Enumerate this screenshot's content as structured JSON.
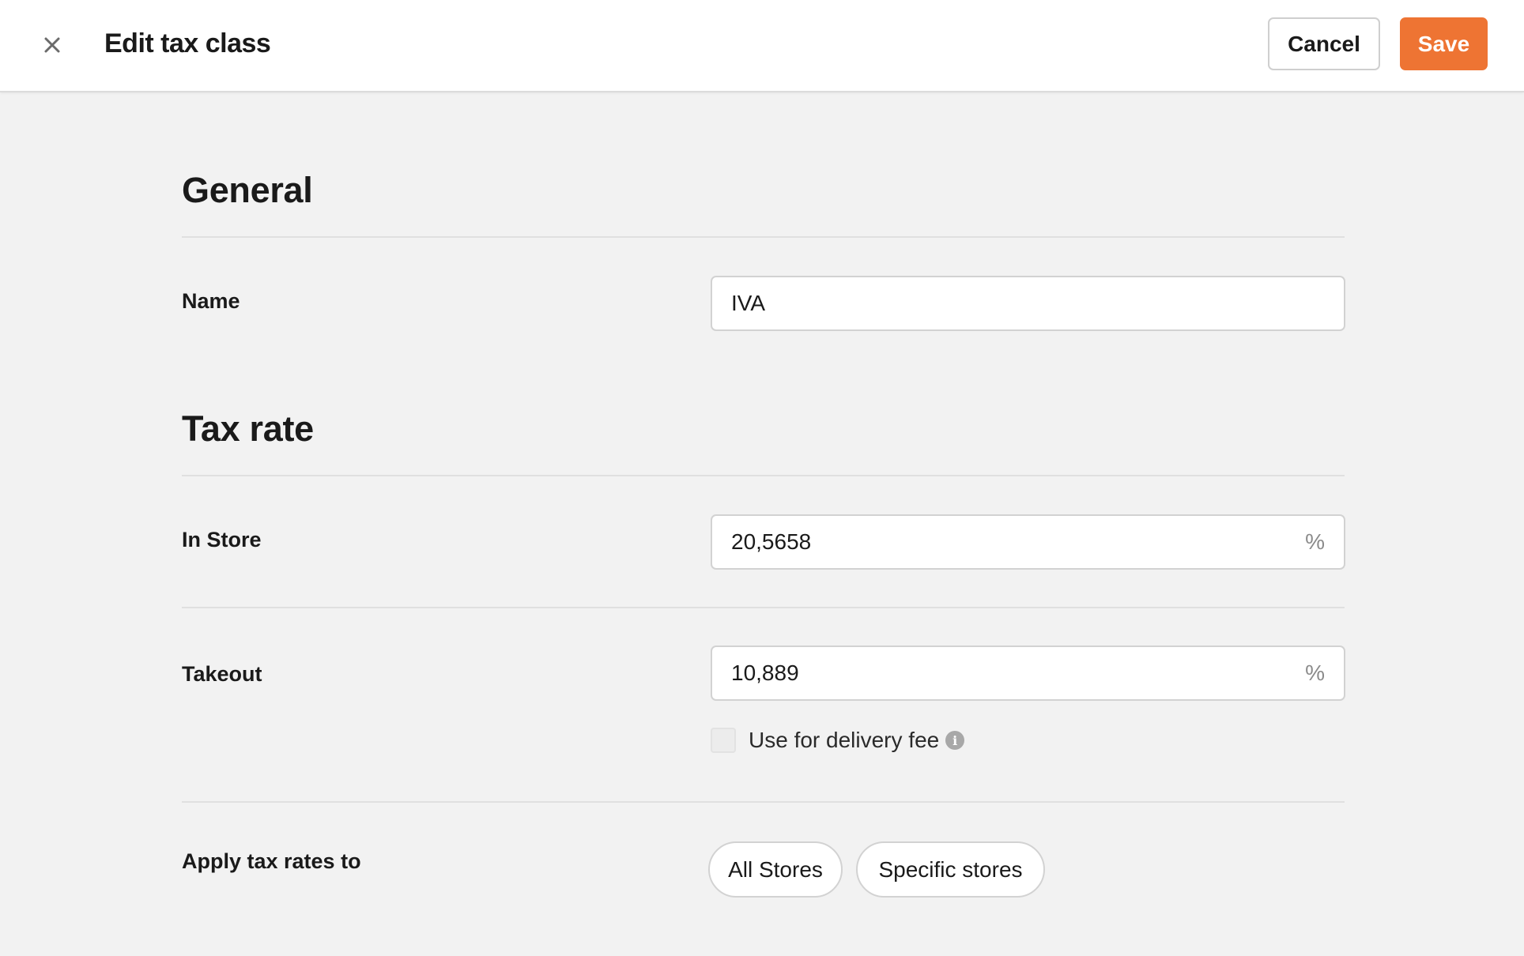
{
  "header": {
    "title": "Edit tax class",
    "close_icon": "close-icon",
    "cancel_label": "Cancel",
    "save_label": "Save",
    "accent_color": "#ee7433"
  },
  "general": {
    "title": "General",
    "name_label": "Name",
    "name_value": "IVA"
  },
  "tax_rate": {
    "title": "Tax rate",
    "in_store_label": "In Store",
    "in_store_value": "20,5658",
    "in_store_suffix": "%",
    "takeout_label": "Takeout",
    "takeout_value": "10,889",
    "takeout_suffix": "%",
    "delivery_fee_label": "Use for delivery fee",
    "delivery_fee_checked": false,
    "info_icon": "info-icon",
    "apply_label": "Apply tax rates to",
    "apply_options": [
      "All Stores",
      "Specific stores"
    ]
  }
}
